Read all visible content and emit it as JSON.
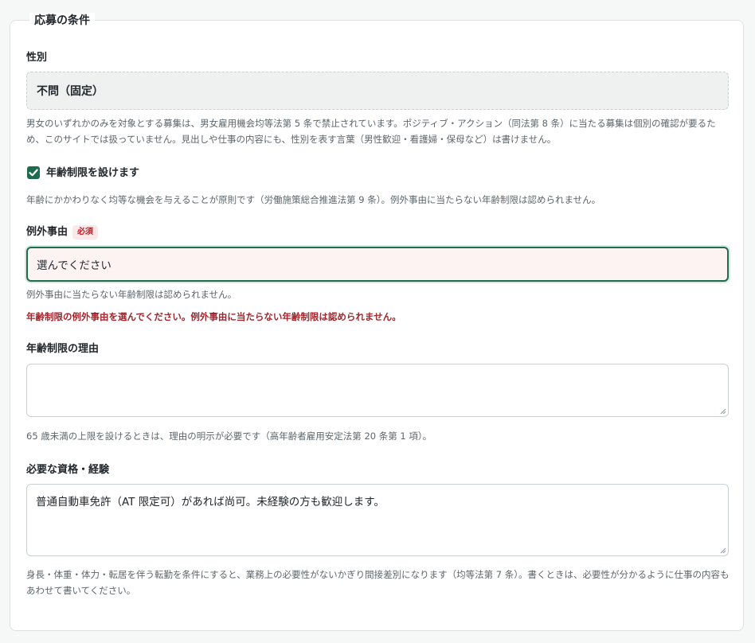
{
  "section": {
    "legend": "応募の条件"
  },
  "gender": {
    "label": "性別",
    "value": "不問（固定）",
    "help": "男女のいずれかのみを対象とする募集は、男女雇用機会均等法第 5 条で禁止されています。ポジティブ・アクション（同法第 8 条）に当たる募集は個別の確認が要るため、このサイトでは扱っていません。見出しや仕事の内容にも、性別を表す言葉（男性歓迎・看護婦・保母など）は書けません。"
  },
  "age_limit": {
    "checkbox_label": "年齢制限を設けます",
    "checked": true,
    "help": "年齢にかかわりなく均等な機会を与えることが原則です（労働施策総合推進法第 9 条）。例外事由に当たらない年齢制限は認められません。"
  },
  "exception": {
    "label": "例外事由",
    "required_badge": "必須",
    "select_value": "選んでください",
    "help": "例外事由に当たらない年齢制限は認められません。",
    "error": "年齢制限の例外事由を選んでください。例外事由に当たらない年齢制限は認められません。"
  },
  "age_reason": {
    "label": "年齢制限の理由",
    "value": "",
    "help": "65 歳未満の上限を設けるときは、理由の明示が必要です（高年齢者雇用安定法第 20 条第 1 項）。"
  },
  "qualifications": {
    "label": "必要な資格・経験",
    "value": "普通自動車免許（AT 限定可）があれば尚可。未経験の方も歓迎します。",
    "help": "身長・体重・体力・転居を伴う転勤を条件にすると、業務上の必要性がないかぎり間接差別になります（均等法第 7 条）。書くときは、必要性が分かるように仕事の内容もあわせて書いてください。"
  },
  "colors": {
    "accent": "#1f6b4e",
    "error": "#a3262c",
    "select_bg": "#fdf3f3",
    "fixed_bg": "#eef1f0"
  }
}
